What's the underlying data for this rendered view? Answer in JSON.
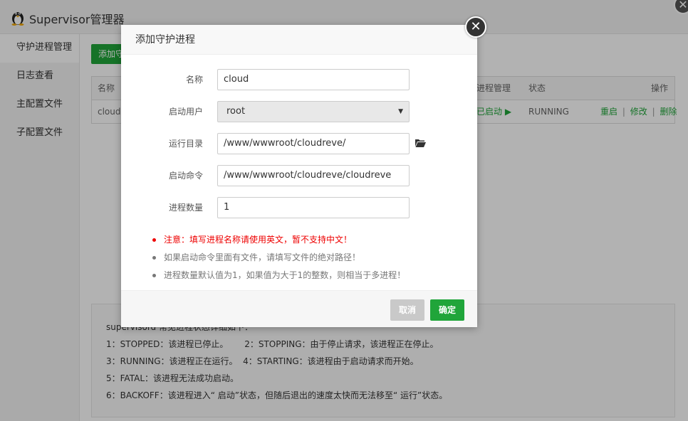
{
  "window": {
    "title": "Supervisor管理器",
    "close_glyph": "✕"
  },
  "sidebar": {
    "items": [
      {
        "label": "守护进程管理"
      },
      {
        "label": "日志查看"
      },
      {
        "label": "主配置文件"
      },
      {
        "label": "子配置文件"
      }
    ]
  },
  "main": {
    "add_button_label": "添加守护进程",
    "table": {
      "headers": {
        "name": "名称",
        "process_mgmt": "进程管理",
        "status": "状态",
        "actions": "操作"
      },
      "row": {
        "name": "cloudreve",
        "process_mgmt": "已启动 ▶",
        "status": "RUNNING",
        "action_restart": "重启",
        "action_edit": "修改",
        "action_delete": "删除",
        "separator": "|"
      }
    },
    "info_lines": [
      "supervisord 常见进程状态详细如下：",
      "1：STOPPED：该进程已停止。      2：STOPPING：由于停止请求，该进程正在停止。",
      "3：RUNNING：该进程正在运行。  4：STARTING：该进程由于启动请求而开始。",
      "5：FATAL：该进程无法成功启动。",
      "6：BACKOFF：该进程进入“ 启动”状态，但随后退出的速度太快而无法移至“ 运行”状态。"
    ]
  },
  "modal": {
    "title": "添加守护进程",
    "close_glyph": "✕",
    "fields": {
      "name": {
        "label": "名称",
        "value": "cloud"
      },
      "user": {
        "label": "启动用户",
        "value": "root"
      },
      "dir": {
        "label": "运行目录",
        "value": "/www/wwwroot/cloudreve/"
      },
      "cmd": {
        "label": "启动命令",
        "value": "/www/wwwroot/cloudreve/cloudreve"
      },
      "count": {
        "label": "进程数量",
        "value": "1"
      }
    },
    "notes": [
      "注意：填写进程名称请使用英文，暂不支持中文！",
      "如果启动命令里面有文件，请填写文件的绝对路径！",
      "进程数量默认值为1，如果值为大于1的整数，则相当于多进程！"
    ],
    "cancel_label": "取消",
    "ok_label": "确定"
  },
  "colors": {
    "accent": "#20a53a",
    "warning": "#e00000"
  }
}
